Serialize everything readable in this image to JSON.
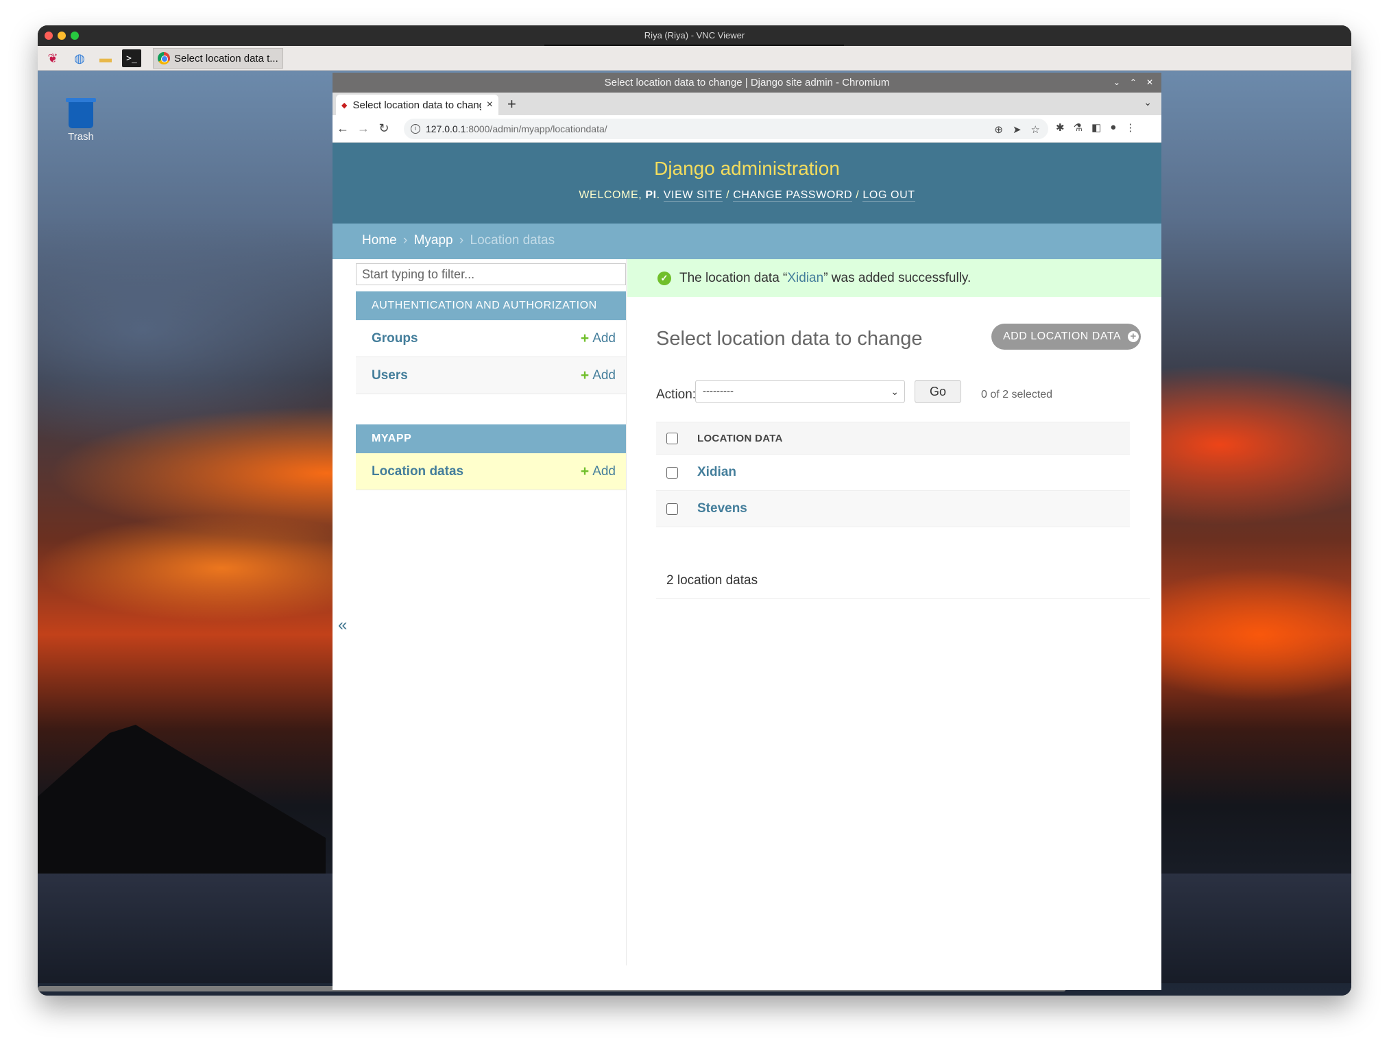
{
  "mac": {
    "title": "Riya (Riya) - VNC Viewer"
  },
  "desktop": {
    "task_label": "Select location data t...",
    "trash_label": "Trash",
    "terminal_glyph": ">_"
  },
  "browser": {
    "window_title": "Select location data to change | Django site admin - Chromium",
    "tab_title": "Select location data to change",
    "url_host": "127.0.0.1",
    "url_rest": ":8000/admin/myapp/locationdata/"
  },
  "django": {
    "brand": "Django administration",
    "welcome": "WELCOME,",
    "user": "PI",
    "view_site": "VIEW SITE",
    "change_password": "CHANGE PASSWORD",
    "log_out": "LOG OUT",
    "breadcrumbs": [
      "Home",
      "Myapp",
      "Location datas"
    ],
    "filter_placeholder": "Start typing to filter...",
    "modules": [
      {
        "caption": "AUTHENTICATION AND AUTHORIZATION",
        "rows": [
          {
            "name": "Groups",
            "add": "Add"
          },
          {
            "name": "Users",
            "add": "Add"
          }
        ]
      },
      {
        "caption": "MYAPP",
        "rows": [
          {
            "name": "Location datas",
            "add": "Add"
          }
        ]
      }
    ],
    "message": {
      "prefix": "The location data “",
      "link": "Xidian",
      "suffix": "” was added successfully."
    },
    "page_title": "Select location data to change",
    "add_button": "ADD LOCATION DATA",
    "action_label": "Action:",
    "action_selected": "---------",
    "go": "Go",
    "counter": "0 of 2 selected",
    "column_header": "LOCATION DATA",
    "rows": [
      "Xidian",
      "Stevens"
    ],
    "paginator": "2 location datas"
  }
}
